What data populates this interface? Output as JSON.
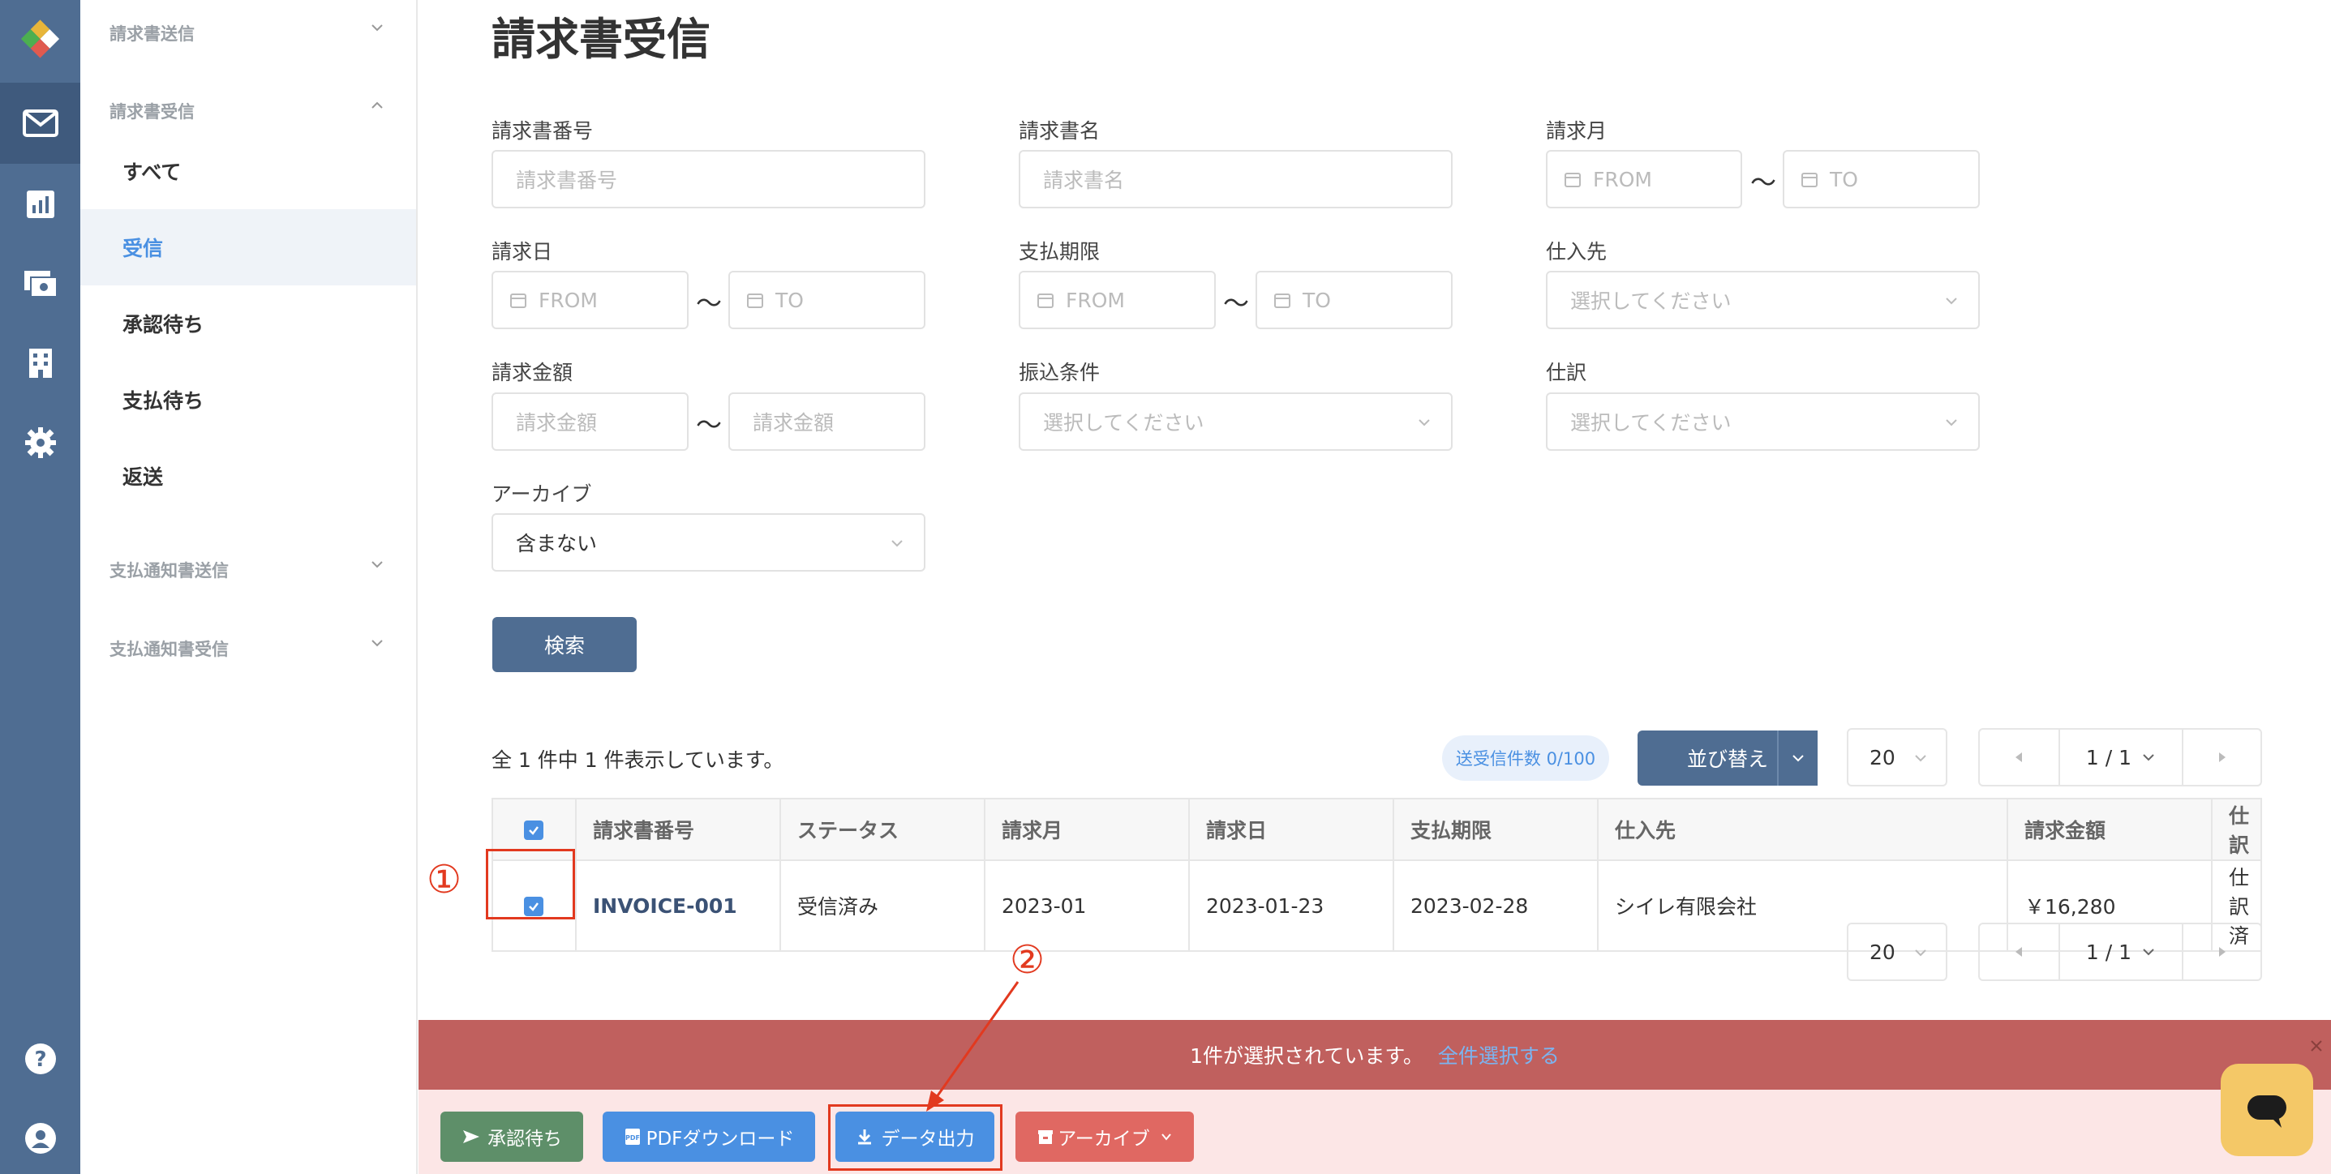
{
  "page_title": "請求書受信",
  "sidebar": {
    "group_send": "請求書送信",
    "group_receive": "請求書受信",
    "items": [
      {
        "label": "すべて"
      },
      {
        "label": "受信"
      },
      {
        "label": "承認待ち"
      },
      {
        "label": "支払待ち"
      },
      {
        "label": "返送"
      }
    ],
    "group_payment_send": "支払通知書送信",
    "group_payment_receive": "支払通知書受信"
  },
  "filters": {
    "invoice_no": {
      "label": "請求書番号",
      "placeholder": "請求書番号"
    },
    "invoice_name": {
      "label": "請求書名",
      "placeholder": "請求書名"
    },
    "invoice_month": {
      "label": "請求月",
      "from": "FROM",
      "to": "TO"
    },
    "invoice_date": {
      "label": "請求日",
      "from": "FROM",
      "to": "TO"
    },
    "due_date": {
      "label": "支払期限",
      "from": "FROM",
      "to": "TO"
    },
    "supplier": {
      "label": "仕入先",
      "placeholder": "選択してください"
    },
    "amount": {
      "label": "請求金額",
      "from": "請求金額",
      "to": "請求金額"
    },
    "transfer": {
      "label": "振込条件",
      "placeholder": "選択してください"
    },
    "journal": {
      "label": "仕訳",
      "placeholder": "選択してください"
    },
    "archive": {
      "label": "アーカイブ",
      "value": "含まない"
    },
    "tilde": "〜",
    "search_button": "検索"
  },
  "results": {
    "summary": "全 1 件中 1 件表示しています。",
    "send_count_badge": "送受信件数 0/100",
    "sort_button": "並び替え",
    "page_size": "20",
    "page": "1 / 1"
  },
  "table": {
    "headers": [
      "請求書番号",
      "ステータス",
      "請求月",
      "請求日",
      "支払期限",
      "仕入先",
      "請求金額",
      "仕訳"
    ],
    "rows": [
      {
        "invoice_no": "INVOICE-001",
        "status": "受信済み",
        "month": "2023-01",
        "date": "2023-01-23",
        "due": "2023-02-28",
        "supplier": "シイレ有限会社",
        "amount": "￥16,280",
        "journal": "仕訳済"
      }
    ]
  },
  "selection_bar": {
    "text": "1件が選択されています。",
    "select_all": "全件選択する"
  },
  "actions": {
    "approve": "承認待ち",
    "pdf": "PDFダウンロード",
    "export": "データ出力",
    "archive": "アーカイブ"
  },
  "annotations": {
    "step1": "①",
    "step2": "②"
  },
  "colors": {
    "rail": "#4f6d92",
    "primary": "#4a90e2",
    "selection_bar": "#c0605e",
    "approve": "#5e8f69",
    "archive": "#e06862",
    "annotation": "#e2391f"
  }
}
